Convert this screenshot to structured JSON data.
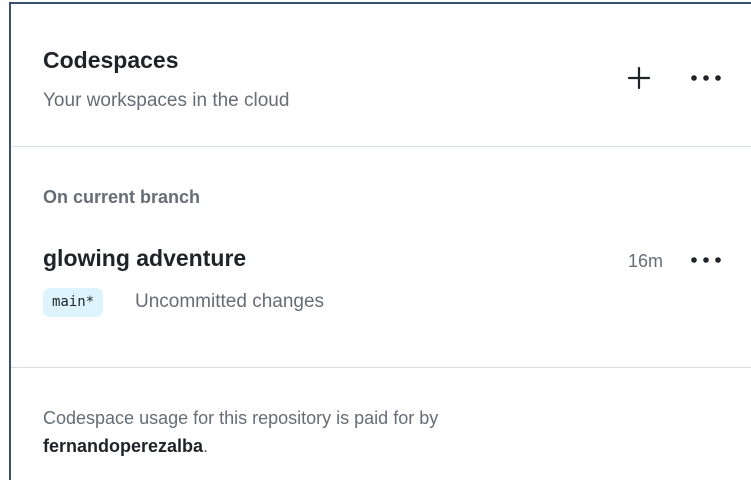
{
  "header": {
    "title": "Codespaces",
    "subtitle": "Your workspaces in the cloud",
    "add_icon": "plus-icon",
    "more_icon": "kebab-horizontal-icon"
  },
  "current_branch_section": {
    "label": "On current branch",
    "codespaces": [
      {
        "name": "glowing adventure",
        "age": "16m",
        "branch": "main*",
        "status": "Uncommitted changes",
        "more_icon": "kebab-horizontal-icon"
      }
    ]
  },
  "footer": {
    "text_prefix": "Codespace usage for this repository is paid for by",
    "owner": "fernandoperezalba",
    "text_suffix": "."
  },
  "colors": {
    "primary_text": "#1f2328",
    "muted_text": "#656d76",
    "divider": "#d8dee4",
    "branch_badge_bg": "#ddf4ff",
    "window_border": "#3a5070"
  }
}
